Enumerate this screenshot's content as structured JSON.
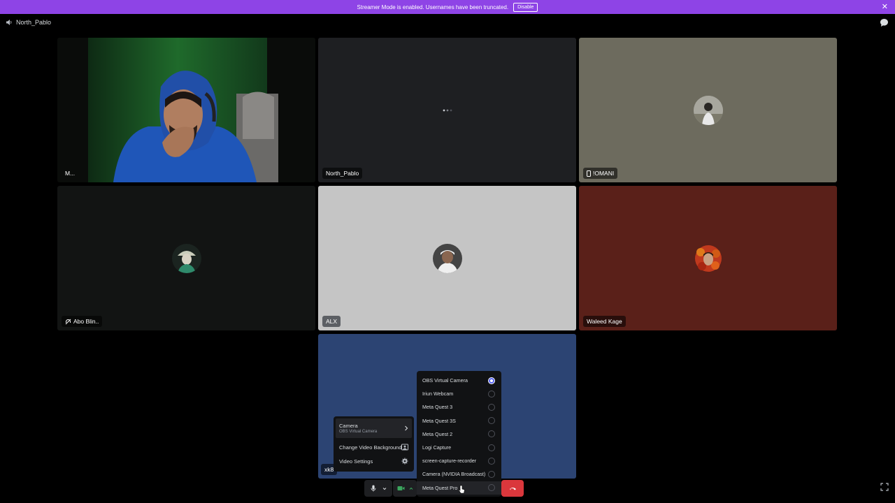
{
  "banner": {
    "text": "Streamer Mode is enabled. Usernames have been truncated.",
    "button": "Disable"
  },
  "channel": {
    "name": "North_Pablo"
  },
  "tiles": [
    {
      "name": "M..."
    },
    {
      "name": "North_Pablo"
    },
    {
      "name": "!OMANI"
    },
    {
      "name": "Abo Blin.."
    },
    {
      "name": "ALX"
    },
    {
      "name": "Waleed Kage"
    },
    {
      "name": "xk8"
    }
  ],
  "camera_menu": {
    "camera_label": "Camera",
    "camera_value": "OBS Virtual Camera",
    "change_background": "Change Video Background",
    "video_settings": "Video Settings"
  },
  "camera_options": {
    "selected": "OBS Virtual Camera",
    "items": [
      "OBS Virtual Camera",
      "Iriun Webcam",
      "Meta Quest 3",
      "Meta Quest 3S",
      "Meta Quest 2",
      "Logi Capture",
      "screen-capture-recorder",
      "Camera (NVIDIA Broadcast)",
      "Meta Quest Pro"
    ]
  },
  "colors": {
    "banner": "#8e44e6",
    "accent": "#5865f2",
    "hangup": "#da373c",
    "camera_on": "#248046"
  }
}
